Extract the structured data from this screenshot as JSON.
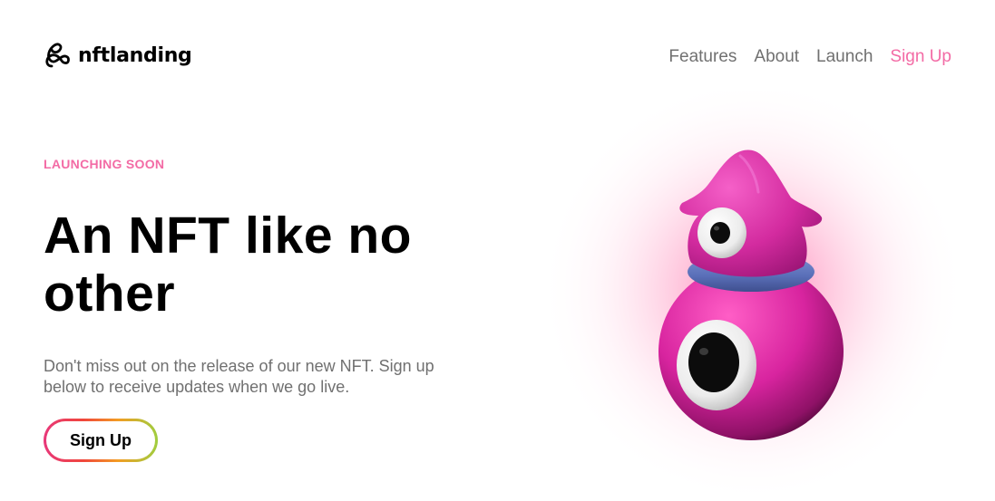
{
  "brand": {
    "name": "nftlanding",
    "accent": "#f36ba5"
  },
  "nav": {
    "items": [
      {
        "label": "Features"
      },
      {
        "label": "About"
      },
      {
        "label": "Launch"
      },
      {
        "label": "Sign Up"
      }
    ]
  },
  "hero": {
    "eyebrow": "LAUNCHING SOON",
    "headline": "An NFT like no other",
    "description": "Don't miss out on the release of our new NFT. Sign up below to receive updates when we go live.",
    "cta_label": "Sign Up"
  },
  "icons": {
    "logo": "nftlanding-logo-icon",
    "illustration": "pink-creature-nft-illustration"
  }
}
